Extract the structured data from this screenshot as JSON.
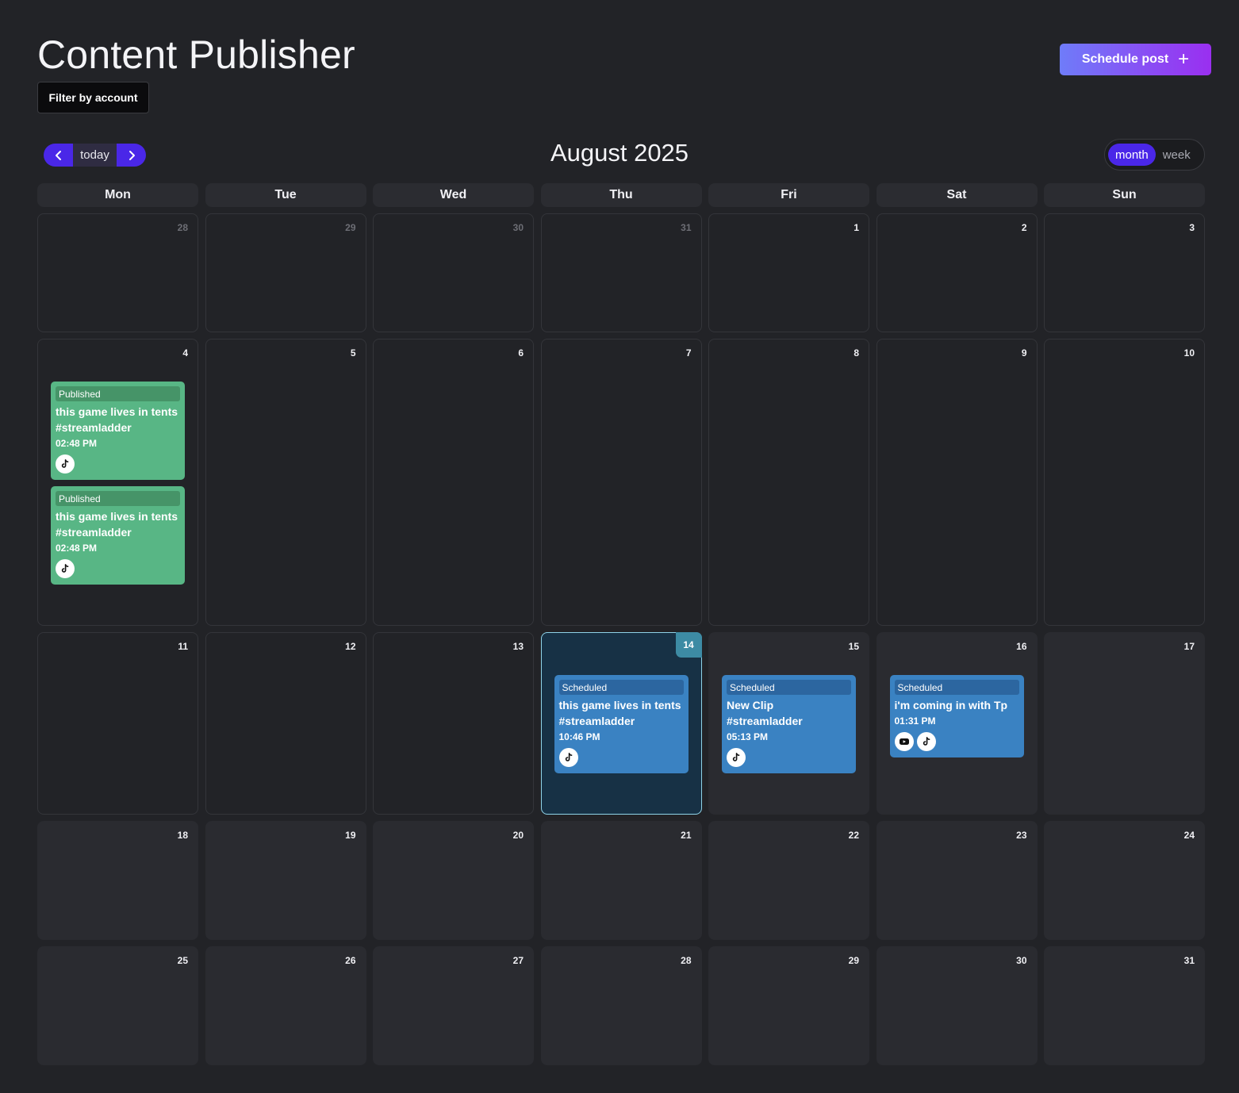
{
  "header": {
    "title": "Content Publisher",
    "filter_label": "Filter by account",
    "schedule_label": "Schedule post",
    "schedule_icon": "plus-icon"
  },
  "toolbar": {
    "prev_icon": "chevron-left-icon",
    "today_label": "today",
    "next_icon": "chevron-right-icon",
    "month_label": "August 2025",
    "views": [
      {
        "label": "month",
        "active": true
      },
      {
        "label": "week",
        "active": false
      }
    ]
  },
  "colors": {
    "accent": "#4a27e8",
    "published": "#58b685",
    "scheduled": "#3a82c2",
    "today_border": "#8fd3e8"
  },
  "calendar": {
    "weekdays": [
      "Mon",
      "Tue",
      "Wed",
      "Thu",
      "Fri",
      "Sat",
      "Sun"
    ],
    "weeks": [
      {
        "days": [
          {
            "num": "28",
            "other": true
          },
          {
            "num": "29",
            "other": true
          },
          {
            "num": "30",
            "other": true
          },
          {
            "num": "31",
            "other": true
          },
          {
            "num": "1"
          },
          {
            "num": "2"
          },
          {
            "num": "3"
          }
        ]
      },
      {
        "days": [
          {
            "num": "4",
            "events": [
              {
                "status": "Published",
                "type": "published",
                "title": "this game lives in tents #streamladder",
                "time": "02:48 PM",
                "platforms": [
                  "tiktok-icon"
                ]
              },
              {
                "status": "Published",
                "type": "published",
                "title": "this game lives in tents #streamladder",
                "time": "02:48 PM",
                "platforms": [
                  "tiktok-icon"
                ]
              }
            ]
          },
          {
            "num": "5"
          },
          {
            "num": "6"
          },
          {
            "num": "7"
          },
          {
            "num": "8"
          },
          {
            "num": "9"
          },
          {
            "num": "10"
          }
        ]
      },
      {
        "days": [
          {
            "num": "11"
          },
          {
            "num": "12"
          },
          {
            "num": "13"
          },
          {
            "num": "14",
            "today": true,
            "events": [
              {
                "status": "Scheduled",
                "type": "scheduled",
                "title": "this game lives in tents #streamladder",
                "time": "10:46 PM",
                "platforms": [
                  "tiktok-icon"
                ]
              }
            ]
          },
          {
            "num": "15",
            "filled": true,
            "events": [
              {
                "status": "Scheduled",
                "type": "scheduled",
                "title": "New Clip #streamladder",
                "time": "05:13 PM",
                "platforms": [
                  "tiktok-icon"
                ]
              }
            ]
          },
          {
            "num": "16",
            "filled": true,
            "events": [
              {
                "status": "Scheduled",
                "type": "scheduled",
                "title": "i'm coming in with Tp",
                "time": "01:31 PM",
                "platforms": [
                  "youtube-icon",
                  "tiktok-icon"
                ]
              }
            ]
          },
          {
            "num": "17",
            "filled": true
          }
        ]
      },
      {
        "days": [
          {
            "num": "18",
            "filled": true
          },
          {
            "num": "19",
            "filled": true
          },
          {
            "num": "20",
            "filled": true
          },
          {
            "num": "21",
            "filled": true
          },
          {
            "num": "22",
            "filled": true
          },
          {
            "num": "23",
            "filled": true
          },
          {
            "num": "24",
            "filled": true
          }
        ]
      },
      {
        "days": [
          {
            "num": "25",
            "filled": true
          },
          {
            "num": "26",
            "filled": true
          },
          {
            "num": "27",
            "filled": true
          },
          {
            "num": "28",
            "filled": true
          },
          {
            "num": "29",
            "filled": true
          },
          {
            "num": "30",
            "filled": true
          },
          {
            "num": "31",
            "filled": true
          }
        ]
      }
    ]
  }
}
